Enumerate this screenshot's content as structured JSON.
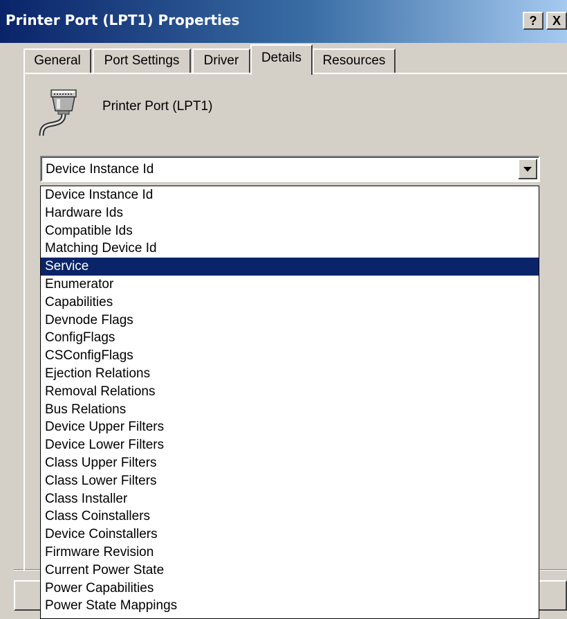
{
  "window": {
    "title": "Printer Port (LPT1) Properties",
    "help_label": "?",
    "close_label": "X"
  },
  "tabs": [
    {
      "label": "General"
    },
    {
      "label": "Port Settings"
    },
    {
      "label": "Driver"
    },
    {
      "label": "Details",
      "active": true
    },
    {
      "label": "Resources"
    }
  ],
  "device": {
    "name": "Printer Port (LPT1)",
    "icon": "parallel-port-icon"
  },
  "property_combo": {
    "value": "Device Instance Id",
    "options": [
      "Device Instance Id",
      "Hardware Ids",
      "Compatible Ids",
      "Matching Device Id",
      "Service",
      "Enumerator",
      "Capabilities",
      "Devnode Flags",
      "ConfigFlags",
      "CSConfigFlags",
      "Ejection Relations",
      "Removal Relations",
      "Bus Relations",
      "Device Upper Filters",
      "Device Lower Filters",
      "Class Upper Filters",
      "Class Lower Filters",
      "Class Installer",
      "Class Coinstallers",
      "Device Coinstallers",
      "Firmware Revision",
      "Current Power State",
      "Power Capabilities",
      "Power State Mappings"
    ],
    "highlighted": "Service"
  },
  "colors": {
    "title_bar_start": "#0a246a",
    "title_bar_end": "#a6caf0",
    "dialog_face": "#d4d0c8",
    "selection": "#0a246a"
  }
}
